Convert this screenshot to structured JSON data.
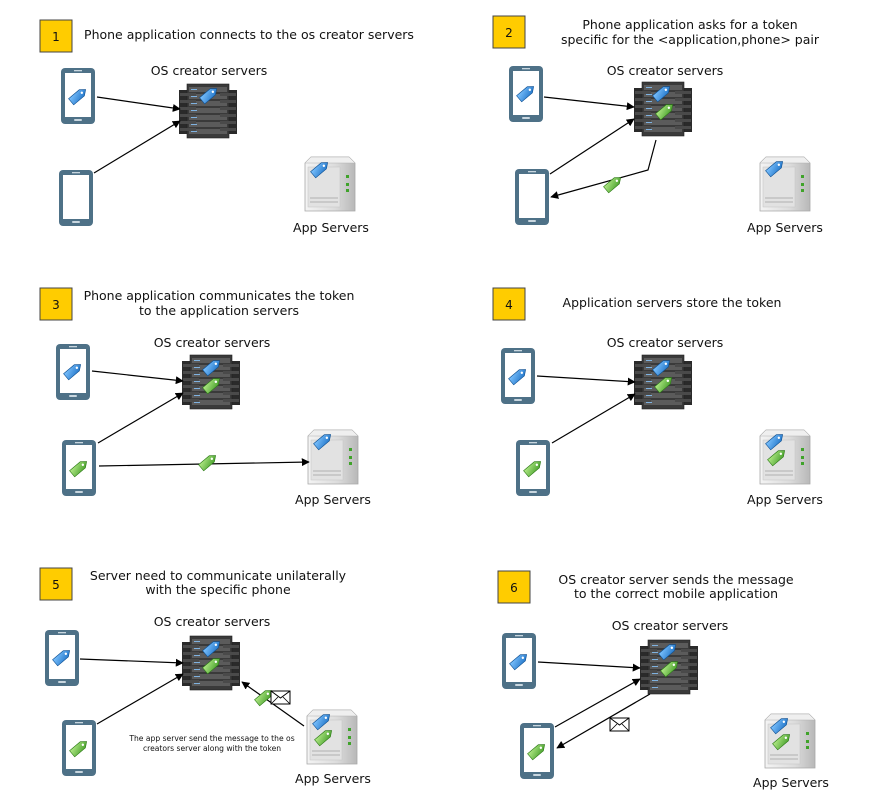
{
  "colors": {
    "badge_fill": "#ffcc00",
    "badge_stroke": "#444444",
    "phone_fill": "#4e7187",
    "phone_screen": "#ffffff",
    "token_blue": "#2f8fe0",
    "token_green": "#6cc04a",
    "server_dark": "#3a3a3a",
    "appserver_light": "#e6e6e6"
  },
  "icons": [
    "phone-icon",
    "server-rack-icon",
    "app-server-icon",
    "token-tag-icon",
    "envelope-icon",
    "arrow"
  ],
  "panels": [
    {
      "number": "1",
      "title": [
        "Phone application connects to the os creator servers"
      ],
      "os_label": "OS creator servers",
      "app_label": "App Servers"
    },
    {
      "number": "2",
      "title": [
        "Phone application asks for a token",
        "specific for the <application,phone> pair"
      ],
      "os_label": "OS creator servers",
      "app_label": "App Servers"
    },
    {
      "number": "3",
      "title": [
        "Phone application communicates the token",
        "to the application servers"
      ],
      "os_label": "OS creator servers",
      "app_label": "App Servers"
    },
    {
      "number": "4",
      "title": [
        "Application servers store the token"
      ],
      "os_label": "OS creator servers",
      "app_label": "App Servers"
    },
    {
      "number": "5",
      "title": [
        "Server need to communicate unilaterally",
        "with the specific phone"
      ],
      "os_label": "OS creator servers",
      "app_label": "App Servers",
      "note": [
        "The app server send the message to the os",
        "creators server along with the token"
      ]
    },
    {
      "number": "6",
      "title": [
        "OS creator server sends the message",
        "to the correct mobile application"
      ],
      "os_label": "OS creator servers",
      "app_label": "App Servers"
    }
  ]
}
